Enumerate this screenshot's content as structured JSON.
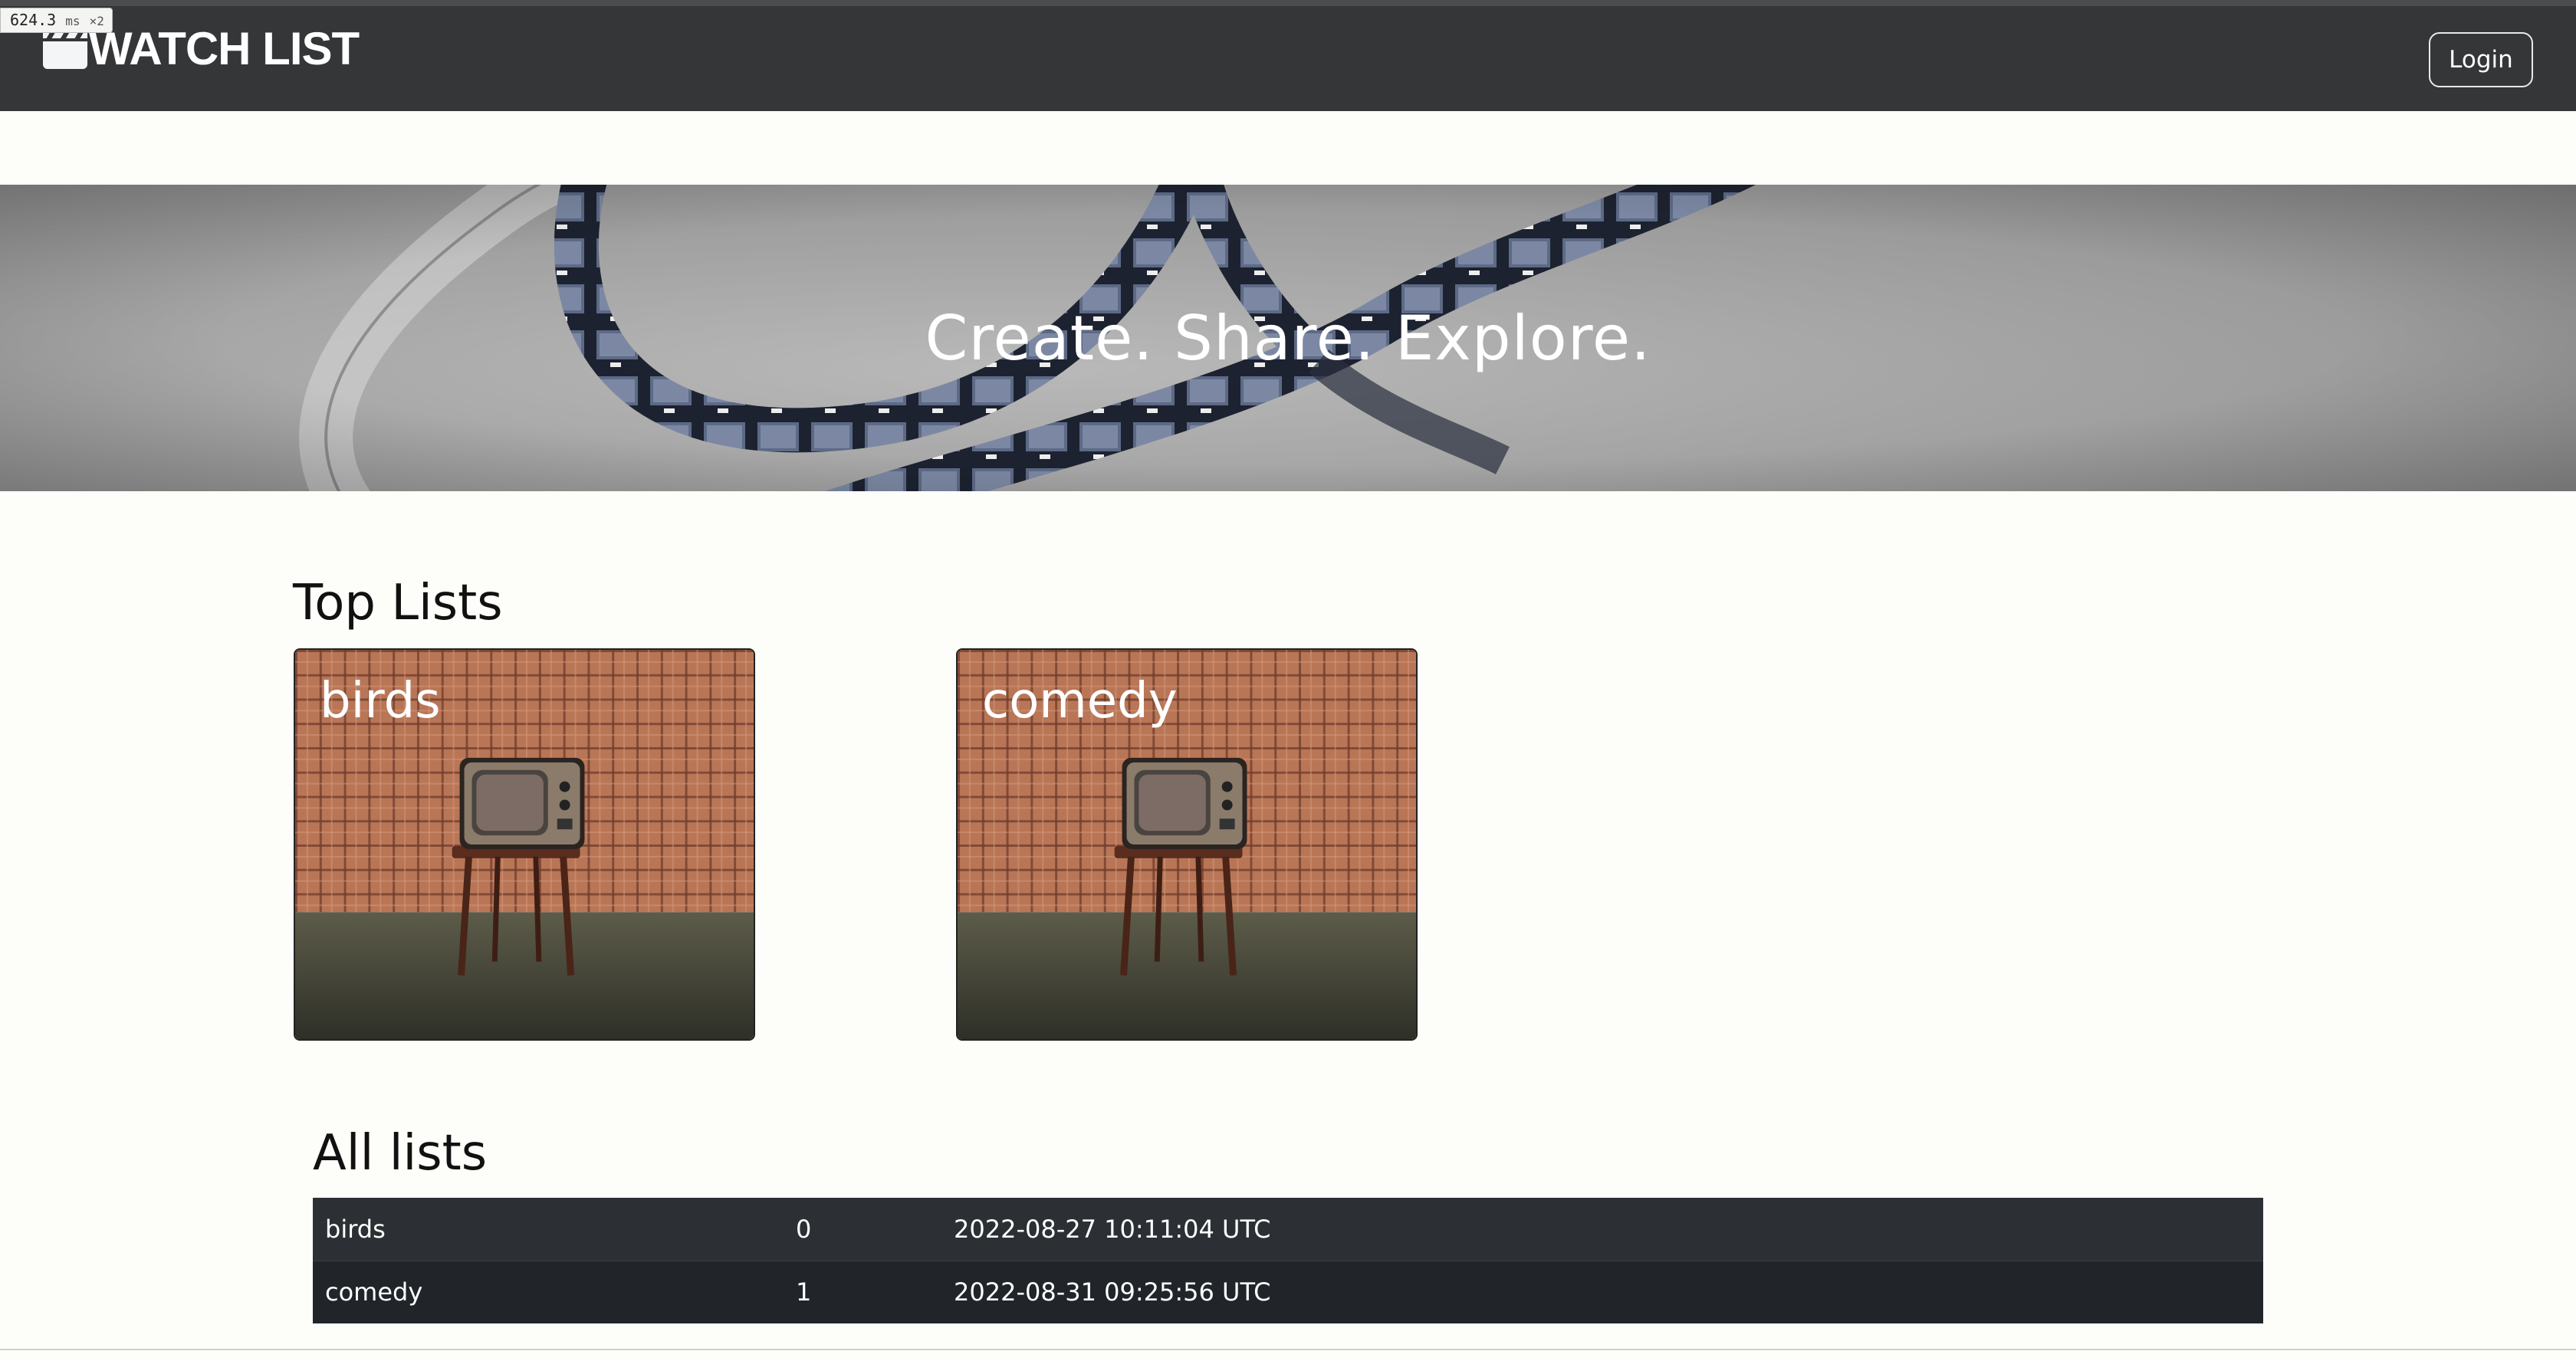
{
  "perf": {
    "value": "624.3",
    "unit": "ms",
    "multiplier": "×2"
  },
  "navbar": {
    "brand": "WATCH LIST",
    "brand_icon": "clapperboard-icon",
    "login_label": "Login"
  },
  "hero": {
    "tagline": "Create. Share. Explore."
  },
  "top_lists": {
    "title": "Top Lists",
    "cards": [
      {
        "name": "birds"
      },
      {
        "name": "comedy"
      }
    ]
  },
  "all_lists": {
    "title": "All lists",
    "rows": [
      {
        "name": "birds",
        "count": "0",
        "created": "2022-08-27 10:11:04 UTC"
      },
      {
        "name": "comedy",
        "count": "1",
        "created": "2022-08-31 09:25:56 UTC"
      }
    ]
  },
  "colors": {
    "navbar": "#343638",
    "table_row_1": "#2c3034",
    "table_row_2": "#212529",
    "page_background": "#fdfdf9"
  }
}
